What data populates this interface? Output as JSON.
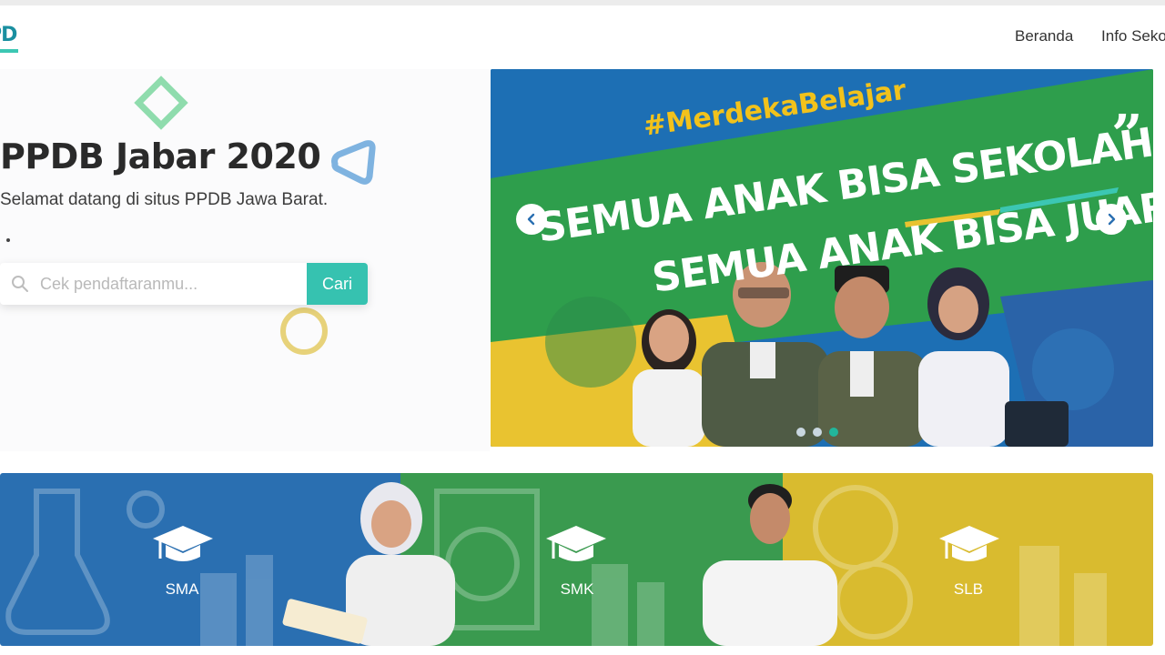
{
  "brand": {
    "logo_text": "PDB"
  },
  "nav": {
    "items": [
      "Beranda",
      "Info Sekolah"
    ]
  },
  "hero": {
    "title": "PPDB Jabar 2020",
    "subtitle": "Selamat datang di situs PPDB Jawa Barat.",
    "search": {
      "placeholder": "Cek pendaftaranmu...",
      "value": "",
      "button_label": "Cari"
    }
  },
  "carousel": {
    "hashtag": "#MerdekaBelajar",
    "slogan_line1": "SEMUA ANAK BISA SEKOLAH",
    "slogan_line2": "SEMUA ANAK BISA JUARA",
    "slide_count": 3,
    "active_slide": 3
  },
  "categories": [
    {
      "label": "SMA",
      "color": "#2a6fb1"
    },
    {
      "label": "SMK",
      "color": "#3a9a4f"
    },
    {
      "label": "SLB",
      "color": "#d9bb2f"
    }
  ],
  "colors": {
    "accent": "#36c2b0",
    "diamond": "#8fdcad",
    "triangle": "#7fb3e0",
    "ring": "#e7d27a"
  }
}
